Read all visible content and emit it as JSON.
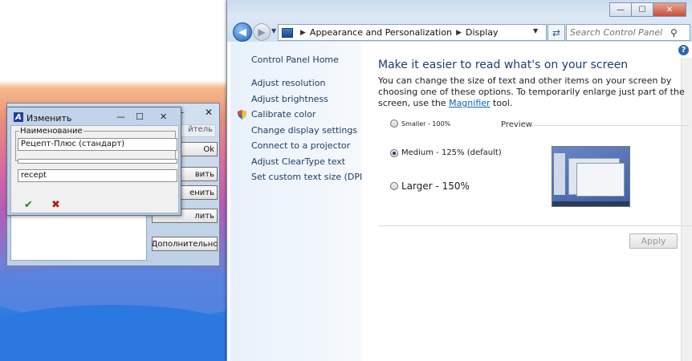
{
  "control_panel": {
    "breadcrumb": [
      "Appearance and Personalization",
      "Display"
    ],
    "search_placeholder": "Search Control Panel",
    "caption": {
      "minimize": "—",
      "maximize": "☐",
      "close": "✕"
    },
    "help": "?",
    "sidebar": {
      "home": "Control Panel Home",
      "items": [
        "Adjust resolution",
        "Adjust brightness",
        "Calibrate color",
        "Change display settings",
        "Connect to a projector",
        "Adjust ClearType text",
        "Set custom text size (DPI)"
      ]
    },
    "heading": "Make it easier to read what's on your screen",
    "description_before": "You can change the size of text and other items on your screen by choosing one of these options. To temporarily enlarge just part of the screen, use the ",
    "description_link": "Magnifier",
    "description_after": " tool.",
    "options": [
      {
        "label": "Smaller - 100%",
        "selected": false
      },
      {
        "label": "Medium - 125% (default)",
        "selected": true
      },
      {
        "label": "Larger - 150%",
        "selected": false
      }
    ],
    "preview_label": "Preview",
    "apply": "Apply"
  },
  "background_window": {
    "header_partial": "йтель",
    "buttons": [
      "Ok",
      "вить",
      "енить",
      "лить",
      "Дополнительно"
    ]
  },
  "edit_dialog": {
    "title": "Изменить",
    "app_icon_letter": "A",
    "group_label": "Наименование",
    "name_value": "Рецепт-Плюс (стандарт)",
    "second_value": "recept",
    "ok_glyph": "✔",
    "cancel_glyph": "✖"
  },
  "icons": {
    "back": "back-arrow-icon",
    "forward": "forward-arrow-icon",
    "search": "search-icon",
    "refresh": "refresh-icon",
    "shield": "shield-icon"
  }
}
